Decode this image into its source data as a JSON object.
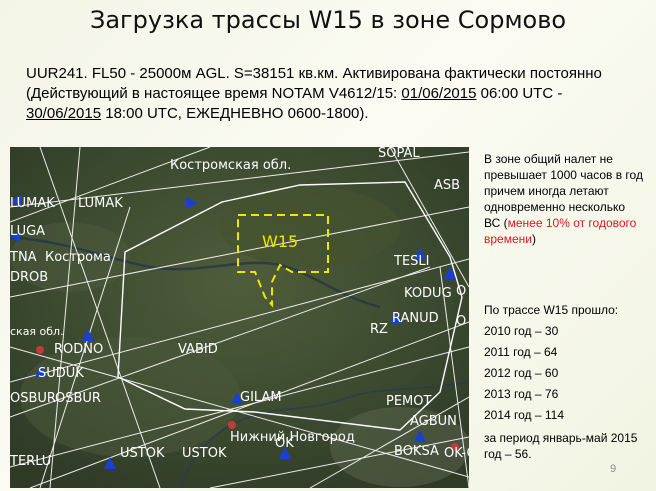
{
  "title": "Загрузка трассы W15 в зоне Сормово",
  "intro": {
    "text_1": "UUR241.  FL50 - 25000м AGL. S=38151 кв.км. Активирована фактически постоянно (Действующий в настоящее время NOTAM   V4612/15: ",
    "date_1": "01/06/2015",
    "text_2": " 06:00 UTC - ",
    "date_2": "30/06/2015",
    "text_3": " 18:00 UTC, ЕЖЕДНЕВНО 0600-1800)."
  },
  "map": {
    "zone_label": "W15",
    "labels": {
      "kostroma_obl": "Костромская обл.",
      "sopal": "SOPAL",
      "lumak_1": "LUMAK",
      "lumak_2": "LUMAK",
      "asb": "ASB",
      "luga": "LUGA",
      "tna": "TNA",
      "kostroma": "Кострома",
      "tesli": "TESLI",
      "drob": "DROB",
      "kodug": "KODUG",
      "ranud": "RANUD",
      "rz": "RZ",
      "o_1": "O",
      "o_2": "O",
      "skaya_obl": "ская обл.",
      "rodno": "RODNO",
      "vabid": "VABID",
      "suduk": "SUDUK",
      "osbur_1": "OSBUR",
      "osbur_2": "OSBUR",
      "gilam": "GILAM",
      "pemot": "PEMOT",
      "agbun": "AGBUN",
      "nn": "Нижний Новгород",
      "terlu": "TERLU",
      "ustok_1": "USTOK",
      "ustok_2": "USTOK",
      "ok": "OK",
      "ok_ok": "OK-OK",
      "boksa": "BOKSA"
    }
  },
  "side_note": {
    "text": "В зоне общий налет не превышает 1000 часов в год причем иногда летают одновременно несколько ВС (",
    "red": "менее 10% от годового времени",
    "close": ")"
  },
  "stats": {
    "heading": "По трассе W15 прошло:",
    "rows": [
      "2010  год – 30",
      "2011  год – 64",
      "2012  год – 60",
      "2013  год – 76",
      "2014  год – 114"
    ],
    "last": "за период январь-май 2015  год – 56."
  },
  "page_number": "9",
  "colors": {
    "zone": "#f2e600",
    "route": "#ffffff",
    "airway": "#1a3fd6",
    "note_accent": "#d21b1b"
  }
}
